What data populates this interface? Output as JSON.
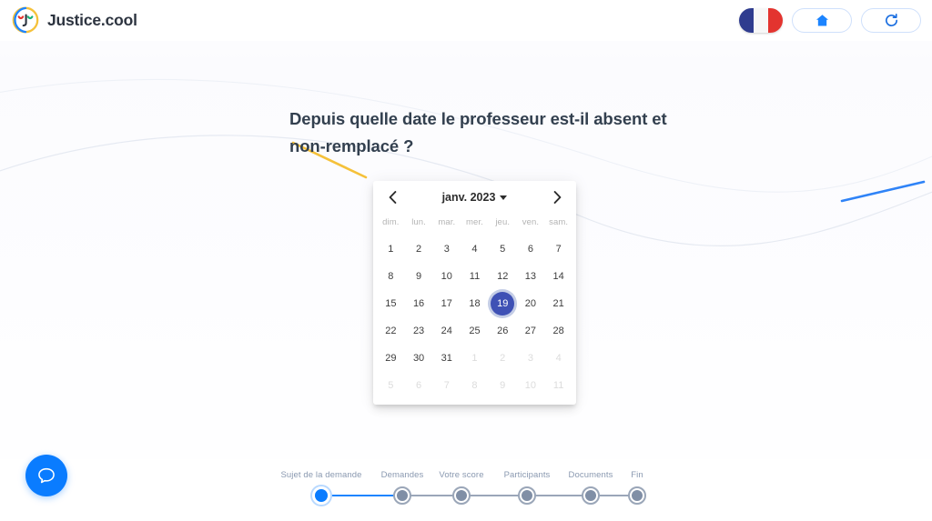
{
  "header": {
    "brand_name": "Justice.cool",
    "logo_icon": "justice-cool-face-logo",
    "flag_icon": "french-flag",
    "flag_label": "Français",
    "home_icon": "home-icon",
    "refresh_icon": "refresh-icon"
  },
  "question": {
    "text": "Depuis quelle date le professeur est-il absent et non-remplacé ?"
  },
  "datepicker": {
    "prev_icon": "chevron-left-icon",
    "next_icon": "chevron-right-icon",
    "month_label": "janv. 2023",
    "caret_icon": "chevron-down-icon",
    "weekdays": [
      "dim.",
      "lun.",
      "mar.",
      "mer.",
      "jeu.",
      "ven.",
      "sam."
    ],
    "selected_day": 19,
    "weeks": [
      [
        {
          "d": "1",
          "muted": false
        },
        {
          "d": "2",
          "muted": false
        },
        {
          "d": "3",
          "muted": false
        },
        {
          "d": "4",
          "muted": false
        },
        {
          "d": "5",
          "muted": false
        },
        {
          "d": "6",
          "muted": false
        },
        {
          "d": "7",
          "muted": false
        }
      ],
      [
        {
          "d": "8",
          "muted": false
        },
        {
          "d": "9",
          "muted": false
        },
        {
          "d": "10",
          "muted": false
        },
        {
          "d": "11",
          "muted": false
        },
        {
          "d": "12",
          "muted": false
        },
        {
          "d": "13",
          "muted": false
        },
        {
          "d": "14",
          "muted": false
        }
      ],
      [
        {
          "d": "15",
          "muted": false
        },
        {
          "d": "16",
          "muted": false
        },
        {
          "d": "17",
          "muted": false
        },
        {
          "d": "18",
          "muted": false
        },
        {
          "d": "19",
          "muted": false,
          "selected": true
        },
        {
          "d": "20",
          "muted": false
        },
        {
          "d": "21",
          "muted": false
        }
      ],
      [
        {
          "d": "22",
          "muted": false
        },
        {
          "d": "23",
          "muted": false
        },
        {
          "d": "24",
          "muted": false
        },
        {
          "d": "25",
          "muted": false
        },
        {
          "d": "26",
          "muted": false
        },
        {
          "d": "27",
          "muted": false
        },
        {
          "d": "28",
          "muted": false
        }
      ],
      [
        {
          "d": "29",
          "muted": false
        },
        {
          "d": "30",
          "muted": false
        },
        {
          "d": "31",
          "muted": false
        },
        {
          "d": "1",
          "muted": true
        },
        {
          "d": "2",
          "muted": true
        },
        {
          "d": "3",
          "muted": true
        },
        {
          "d": "4",
          "muted": true
        }
      ],
      [
        {
          "d": "5",
          "muted": true
        },
        {
          "d": "6",
          "muted": true
        },
        {
          "d": "7",
          "muted": true
        },
        {
          "d": "8",
          "muted": true
        },
        {
          "d": "9",
          "muted": true
        },
        {
          "d": "10",
          "muted": true
        },
        {
          "d": "11",
          "muted": true
        }
      ]
    ]
  },
  "chat": {
    "icon": "chat-bubble-icon"
  },
  "stepper": {
    "active_index": 0,
    "steps": [
      {
        "label": "Sujet de la demande",
        "active": true
      },
      {
        "label": "Demandes",
        "active": false
      },
      {
        "label": "Votre score",
        "active": false
      },
      {
        "label": "Participants",
        "active": false
      },
      {
        "label": "Documents",
        "active": false
      },
      {
        "label": "Fin",
        "active": false
      }
    ]
  },
  "colors": {
    "accent_blue": "#0a7cff",
    "selected_indigo": "#3f51b5",
    "heading": "#33404f",
    "muted": "#8a99b0",
    "decor_yellow": "#f5c13a",
    "decor_blue": "#2f83f7"
  }
}
